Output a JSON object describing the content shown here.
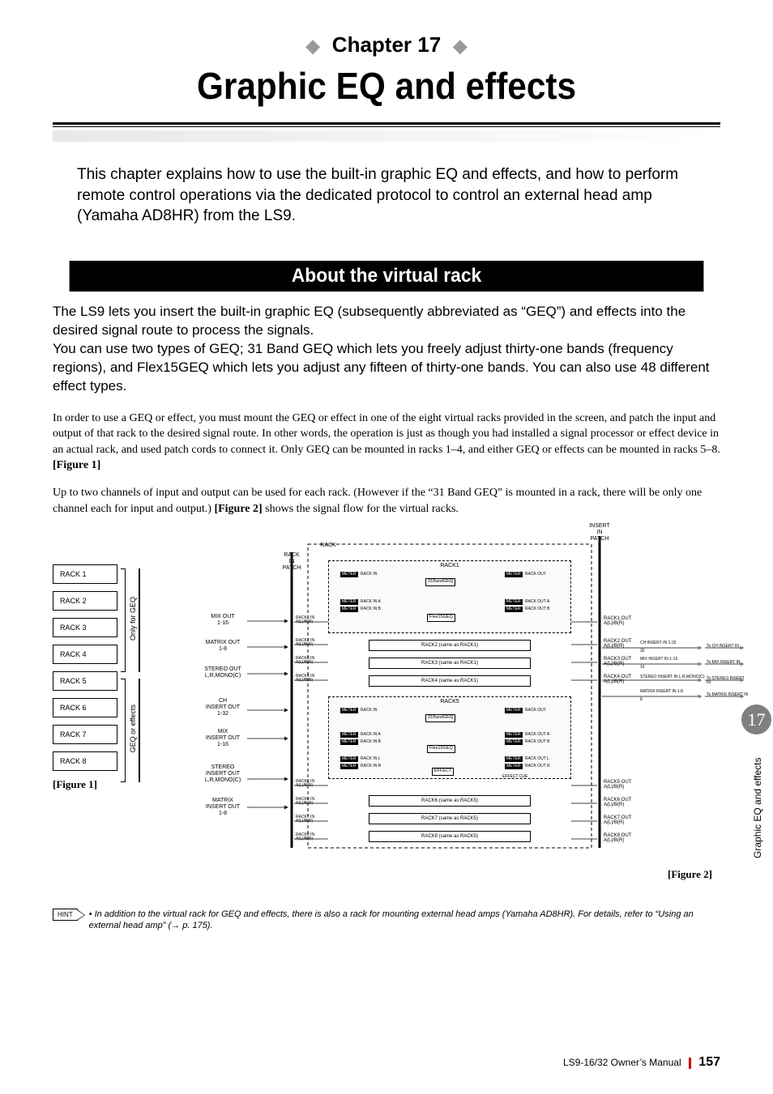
{
  "chapter": {
    "prefix": "Chapter 17"
  },
  "title": "Graphic EQ and effects",
  "intro": "This chapter explains how to use the built-in graphic EQ and effects, and how to perform remote control operations via the dedicated protocol to control an external head amp (Yamaha AD8HR) from the LS9.",
  "section_title": "About the virtual rack",
  "para1": "The LS9 lets you insert the built-in graphic EQ (subsequently abbreviated as “GEQ”) and effects into the desired signal route to process the signals.\nYou can use two types of GEQ; 31 Band GEQ which lets you freely adjust thirty-one bands (frequency regions), and Flex15GEQ which lets you adjust any fifteen of thirty-one bands. You can also use 48 different effect types.",
  "para2_a": "In order to use a GEQ or effect, you must mount the GEQ or effect in one of the eight virtual racks provided in the screen, and patch the input and output of that rack to the desired signal route. In other words, the operation is just as though you had installed a signal processor or effect device in an actual rack, and used patch cords to connect it. Only GEQ can be mounted in racks 1–4, and either GEQ or effects can be mounted in racks 5–8. ",
  "para2_ref": "[Figure 1]",
  "para3_a": "Up to two channels of input and output can be used for each rack. (However if the “31 Band GEQ” is mounted in a rack, there will be only one channel each for input and output.) ",
  "para3_ref": "[Figure 2]",
  "para3_b": " shows the signal flow for the virtual racks.",
  "figure1": {
    "caption": "[Figure 1]",
    "racks": [
      "RACK 1",
      "RACK 2",
      "RACK 3",
      "RACK 4",
      "RACK 5",
      "RACK 6",
      "RACK 7",
      "RACK 8"
    ],
    "label_top": "Only for GEQ",
    "label_bottom": "GEQ or effects"
  },
  "figure2": {
    "caption": "[Figure 2]",
    "inputs": [
      "MIX OUT\n1-16",
      "MATRIX OUT\n1-8",
      "STEREO OUT\nL,R,MONO(C)",
      "CH\nINSERT OUT\n1-32",
      "MIX\nINSERT OUT\n1-16",
      "STEREO\nINSERT OUT\nL,R,MONO(C)",
      "MATRIX\nINSERT OUT\n1-8"
    ],
    "rack_in_patch": "RACK\nIN\nPATCH",
    "insert_in_patch": "INSERT\nIN\nPATCH",
    "rack_label": "RACK",
    "rack1_title": "RACK1",
    "rack5_title": "RACK5",
    "proc_31": "31BandGEQ",
    "proc_flex": "Flex15GEQ",
    "proc_effect": "EFFECT",
    "effect_cue": "EFFECT CUE",
    "meter": "METER",
    "io_labels": {
      "rack_in": "RACK IN",
      "rack_out": "RACK OUT",
      "rack_in_a": "RACK IN A",
      "rack_in_b": "RACK IN B",
      "rack_out_a": "RACK OUT A",
      "rack_out_b": "RACK OUT B",
      "rack_in_l": "RACK IN L",
      "rack_in_r": "RACK IN R",
      "rack_out_l": "RACK OUT L",
      "rack_out_r": "RACK OUT R"
    },
    "rack_same_1": [
      "RACK2 (same as RACK1)",
      "RACK3 (same as RACK1)",
      "RACK4 (same as RACK1)"
    ],
    "rack_same_5": [
      "RACK6 (same as RACK5)",
      "RACK7 (same as RACK5)",
      "RACK8 (same as RACK5)"
    ],
    "rack_io_left": [
      "RACK1 IN\nA(L)/B(R)",
      "RACK2 IN\nA(L)/B(R)",
      "RACK3 IN\nA(L)/B(R)",
      "RACK4 IN\nA(L)/B(R)",
      "RACK5 IN\nA(L)/B(R)",
      "RACK6 IN\nA(L)/B(R)",
      "RACK7 IN\nA(L)/B(R)",
      "RACK8 IN\nA(L)/B(R)"
    ],
    "rack_io_right": [
      "RACK1 OUT\nA(L)/B(R)",
      "RACK2 OUT\nA(L)/B(R)",
      "RACK3 OUT\nA(L)/B(R)",
      "RACK4 OUT\nA(L)/B(R)",
      "RACK5 OUT\nA(L)/B(R)",
      "RACK6 OUT\nA(L)/B(R)",
      "RACK7 OUT\nA(L)/B(R)",
      "RACK8 OUT\nA(L)/B(R)"
    ],
    "dest": [
      {
        "label": "CH INSERT IN 1-32",
        "to": "To CH INSERT IN",
        "n": "32"
      },
      {
        "label": "MIX INSERT IN 1-16",
        "to": "To MIX INSERT IN",
        "n": "16"
      },
      {
        "label": "STEREO INSERT IN L,R,MONO(C)",
        "to": "To STEREO INSERT IN",
        "n": ""
      },
      {
        "label": "MATRIX INSERT IN 1-8",
        "to": "To MATRIX INSERT IN",
        "n": "8"
      }
    ]
  },
  "hint": {
    "label": "HINT",
    "text": "• In addition to the virtual rack for GEQ and effects, there is also a rack for mounting external head amps (Yamaha AD8HR). For details, refer to “Using an external head amp” (→ p. 175)."
  },
  "side": {
    "num": "17",
    "text": "Graphic EQ and effects"
  },
  "footer": {
    "manual": "LS9-16/32  Owner’s Manual",
    "page": "157"
  }
}
